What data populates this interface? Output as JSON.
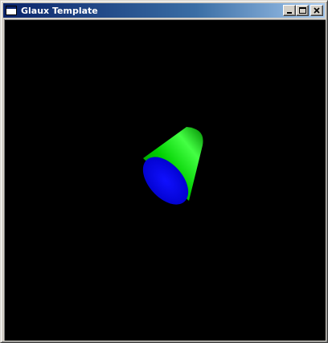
{
  "window": {
    "title": "Glaux Template",
    "title_icon": "window-app-icon",
    "controls": [
      {
        "name": "minimize-button",
        "icon": "minimize-icon"
      },
      {
        "name": "maximize-button",
        "icon": "maximize-icon"
      },
      {
        "name": "close-button",
        "icon": "close-icon"
      }
    ]
  },
  "viewport": {
    "background": "#000000",
    "object": {
      "shape": "cone frustum",
      "side_color": "#00cc00",
      "cap_color": "#0000ee"
    }
  }
}
